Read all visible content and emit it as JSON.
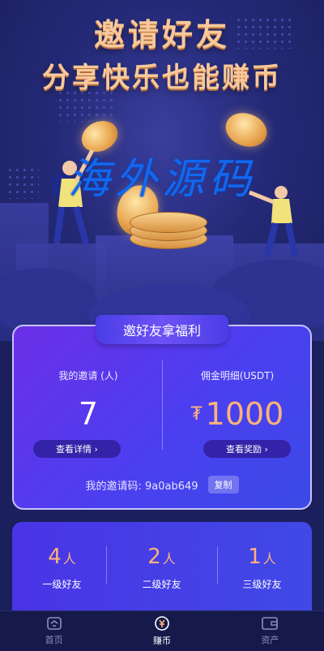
{
  "hero": {
    "title_line1": "邀请好友",
    "title_line2": "分享快乐也能赚币",
    "watermark": "海外源码"
  },
  "card": {
    "tab_title": "邀好友拿福利",
    "my_invites": {
      "label": "我的邀请 (人)",
      "value": "7",
      "button": "查看详情 ›"
    },
    "commission": {
      "label": "佣金明细(USDT)",
      "currency_icon": "₮",
      "value": "1000",
      "button": "查看奖励 ›"
    },
    "invite_code_label": "我的邀请码:",
    "invite_code": "9a0ab649",
    "copy_label": "复制"
  },
  "levels": [
    {
      "count": "4",
      "unit": "人",
      "label": "一级好友"
    },
    {
      "count": "2",
      "unit": "人",
      "label": "二级好友"
    },
    {
      "count": "1",
      "unit": "人",
      "label": "三级好友"
    }
  ],
  "tabbar": [
    {
      "label": "首页",
      "icon": "home-icon",
      "active": false
    },
    {
      "label": "赚币",
      "icon": "earn-coin-icon",
      "active": true
    },
    {
      "label": "资产",
      "icon": "wallet-icon",
      "active": false
    }
  ],
  "colors": {
    "accent_orange": "#ffb27a",
    "card_purple": "#6b2fe8",
    "card_blue": "#3a4ae6",
    "title_gold": "#f7c89a",
    "watermark_blue": "#1268f0"
  }
}
